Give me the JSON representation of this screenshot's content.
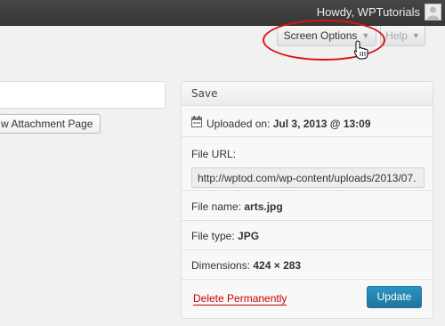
{
  "adminbar": {
    "greeting": "Howdy, WPTutorials",
    "avatar": "avatar-icon"
  },
  "tabs": {
    "screen_options": "Screen Options",
    "help": "Help",
    "caret": "▼"
  },
  "editor": {
    "attachment_page_button": "w Attachment Page"
  },
  "save_box": {
    "title": "Save",
    "uploaded_label": "Uploaded on:",
    "uploaded_value": "Jul 3, 2013 @ 13:09",
    "file_url_label": "File URL:",
    "file_url_value": "http://wptod.com/wp-content/uploads/2013/07.",
    "file_name_label": "File name:",
    "file_name_value": "arts.jpg",
    "file_type_label": "File type:",
    "file_type_value": "JPG",
    "dimensions_label": "Dimensions:",
    "dimensions_value": "424 × 283",
    "delete_link": "Delete Permanently",
    "update_button": "Update"
  },
  "colors": {
    "highlight_ellipse": "#d91414",
    "update_button": "#21759b",
    "delete_link": "#cc0000"
  },
  "icons": [
    "calendar-icon",
    "hand-cursor-icon",
    "caret-down-icon"
  ]
}
